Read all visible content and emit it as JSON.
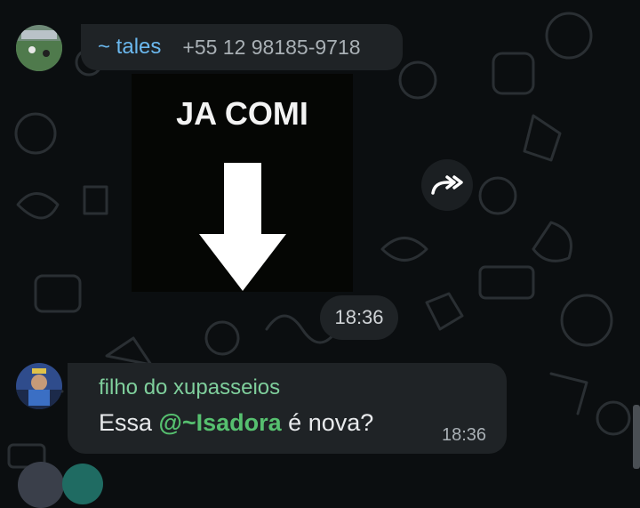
{
  "colors": {
    "background": "#0b0e10",
    "bubble": "#1f2326",
    "tales_name": "#6bb8ee",
    "filho_name": "#7fcf9c",
    "mention": "#56c06f"
  },
  "message1": {
    "sender_name": "~ tales",
    "sender_phone": "+55 12 98185-9718",
    "sticker_text": "JA COMI",
    "time": "18:36",
    "forward_icon": "forward-icon"
  },
  "message2": {
    "sender_name": "filho do xupasseios",
    "text_prefix": "Essa ",
    "mention": "@~Isadora",
    "text_suffix": " é nova?",
    "time": "18:36"
  }
}
